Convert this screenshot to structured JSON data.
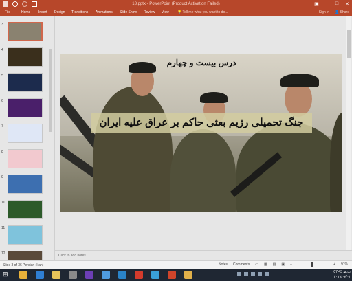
{
  "titlebar": {
    "title": "18.pptx - PowerPoint (Product Activation Failed)",
    "window_controls": [
      "minimize",
      "maximize",
      "close"
    ],
    "quick_access": [
      "save-icon",
      "undo-icon",
      "redo-icon",
      "start-icon"
    ]
  },
  "ribbon": {
    "tabs": [
      "File",
      "Home",
      "Insert",
      "Design",
      "Transitions",
      "Animations",
      "Slide Show",
      "Review",
      "View"
    ],
    "tell_me": "Tell me what you want to do...",
    "sign_in": "Sign in",
    "share": "Share"
  },
  "slides": {
    "numbers": [
      "3",
      "4",
      "5",
      "6",
      "7",
      "8",
      "9",
      "10",
      "11",
      "12"
    ],
    "selected": "3",
    "thumb_colors": [
      "#8a8270",
      "#3a2f1c",
      "#1c2b4d",
      "#4a1f6a",
      "#dfe7f6",
      "#f2c9cf",
      "#3d6fb0",
      "#2d5a2a",
      "#7fc3dc",
      "#5a4a3a"
    ]
  },
  "slide": {
    "heading": "درس بیست و چهارم",
    "title": "جنگ تحمیلی رژیم بعثی حاکم بر عراق علیه ایران"
  },
  "notes": {
    "placeholder": "Click to add notes"
  },
  "status": {
    "left": "Slide 3 of 36   Persian (Iran)",
    "notes": "Notes",
    "comments": "Comments",
    "zoom": "91%"
  },
  "taskbar": {
    "icons": [
      "start-icon",
      "chrome-icon",
      "ie-icon",
      "explorer-icon",
      "files-icon",
      "vs-icon",
      "bluetooth-icon",
      "photo-icon",
      "opera-icon",
      "media-icon",
      "powerpoint-icon",
      "folder-icon"
    ],
    "time": "07:43 ب.ظ",
    "date": "۲۰۱۷/۰۷/۰۱",
    "colors": {
      "titlebar": "#b7472a",
      "taskbar": "#1f2733"
    }
  }
}
